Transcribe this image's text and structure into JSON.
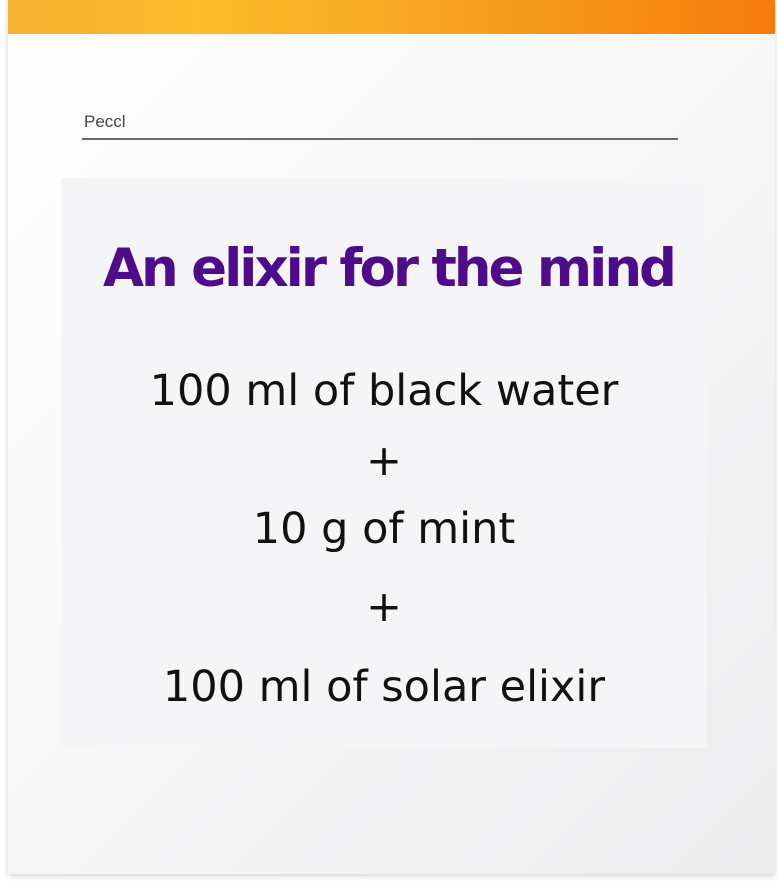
{
  "header": {
    "label": "Peccl"
  },
  "card": {
    "title": "An elixir for the mind",
    "lines": [
      "100 ml of black water",
      "+",
      "10 g of mint",
      "+",
      "100 ml of solar elixir"
    ]
  },
  "colors": {
    "accent_bar": "#f7a11f",
    "title": "#4f0c8a",
    "text": "#111111"
  }
}
